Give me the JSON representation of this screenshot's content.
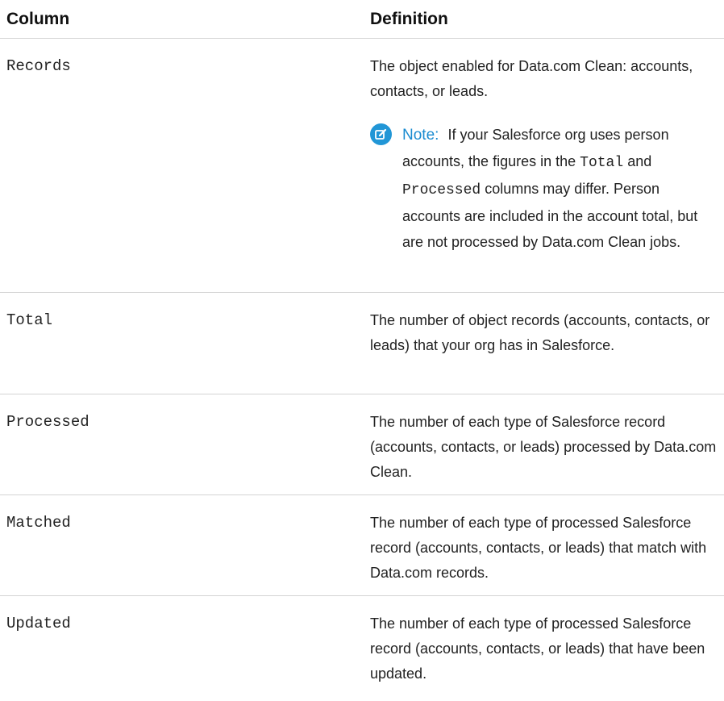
{
  "table": {
    "headers": {
      "column": "Column",
      "definition": "Definition"
    },
    "rows": [
      {
        "term": "Records",
        "definition": "The object enabled for Data.com Clean: accounts, contacts, or leads.",
        "note": {
          "label": "Note:",
          "text_1": "If your Salesforce org uses person accounts, the figures in the",
          "code_1": "Total",
          "text_2": "and",
          "code_2": "Processed",
          "text_3": "columns may differ. Person accounts are included in the account total, but are not processed by Data.com Clean jobs."
        }
      },
      {
        "term": "Total",
        "definition": "The number of object records (accounts, contacts, or leads) that your org has in Salesforce."
      },
      {
        "term": "Processed",
        "definition": "The number of each type of Salesforce record (accounts, contacts, or leads) processed by Data.com Clean."
      },
      {
        "term": "Matched",
        "definition": "The number of each type of processed Salesforce record (accounts, contacts, or leads) that match with Data.com records."
      },
      {
        "term": "Updated",
        "definition": "The number of each type of processed Salesforce record (accounts, contacts, or leads) that have been updated."
      }
    ]
  },
  "colors": {
    "note_accent": "#2196d6",
    "divider": "#d4d4d4"
  },
  "icons": {
    "note": "edit-note-icon"
  }
}
